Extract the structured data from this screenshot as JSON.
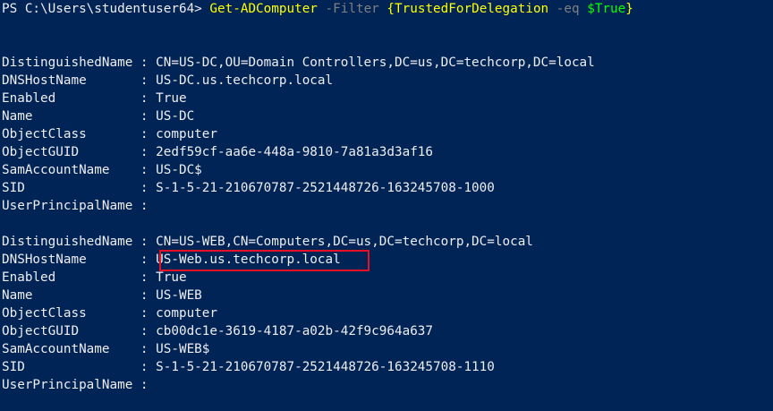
{
  "prompt": {
    "text": "PS C:\\Users\\studentuser64> ",
    "cmdlet": "Get-ADComputer",
    "param": "-Filter",
    "filter_open": "{",
    "filter_prop": "TrustedForDelegation",
    "operator": "-eq",
    "filter_var": "$True",
    "filter_close": "}"
  },
  "results": [
    {
      "DistinguishedName": "DistinguishedName : CN=US-DC,OU=Domain Controllers,DC=us,DC=techcorp,DC=local",
      "DNSHostName": "DNSHostName       : US-DC.us.techcorp.local",
      "Enabled": "Enabled           : True",
      "Name": "Name              : US-DC",
      "ObjectClass": "ObjectClass       : computer",
      "ObjectGUID": "ObjectGUID        : 2edf59cf-aa6e-448a-9810-7a81a3d3af16",
      "SamAccountName": "SamAccountName    : US-DC$",
      "SID": "SID               : S-1-5-21-210670787-2521448726-163245708-1000",
      "UserPrincipalName": "UserPrincipalName :"
    },
    {
      "DistinguishedName": "DistinguishedName : CN=US-WEB,CN=Computers,DC=us,DC=techcorp,DC=local",
      "DNSHostName": "DNSHostName       : US-Web.us.techcorp.local",
      "Enabled": "Enabled           : True",
      "Name": "Name              : US-WEB",
      "ObjectClass": "ObjectClass       : computer",
      "ObjectGUID": "ObjectGUID        : cb00dc1e-3619-4187-a02b-42f9c964a637",
      "SamAccountName": "SamAccountName    : US-WEB$",
      "SID": "SID               : S-1-5-21-210670787-2521448726-163245708-1110",
      "UserPrincipalName": "UserPrincipalName :"
    }
  ],
  "colors": {
    "background": "#012456",
    "text": "#eeedf0",
    "cmdlet": "#ffff00",
    "param": "#808080",
    "variable": "#00ff00",
    "highlight_border": "#e81123"
  }
}
